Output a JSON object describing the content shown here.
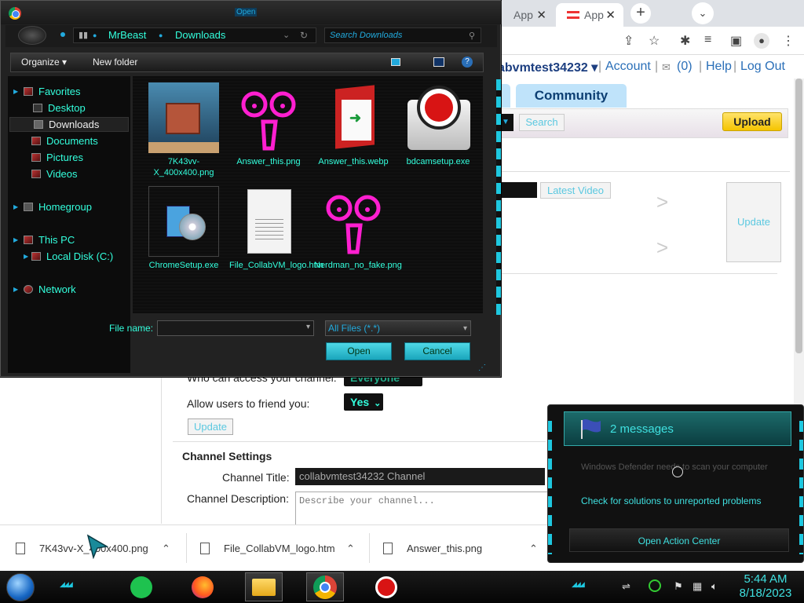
{
  "browser": {
    "tabs": [
      {
        "label": "App",
        "close": "✕"
      },
      {
        "label": "App",
        "close": "✕"
      }
    ],
    "new_tab": "+",
    "tab_menu": "⌄",
    "site": {
      "username": "abvmtest34232 ▾",
      "account": "Account",
      "messages": "(0)",
      "help": "Help",
      "logout": "Log Out",
      "sep": "|"
    },
    "nav_tab": "Community",
    "search_btn": "Search",
    "upload_btn": "Upload",
    "latest_video_btn": "Latest Video",
    "arrow": ">",
    "update_box": "Update",
    "settings": {
      "who_access_label": "Who can access your channel:",
      "who_access_value": "Everyone",
      "friend_label": "Allow users to friend you:",
      "friend_value": "Yes",
      "update_btn": "Update",
      "channel_settings_heading": "Channel Settings",
      "channel_title_label": "Channel Title:",
      "channel_title_value": "collabvmtest34232 Channel",
      "channel_desc_label": "Channel Description:",
      "channel_desc_placeholder": "Describe your channel..."
    },
    "downloads": [
      {
        "name": "7K43vv-X_400x400.png"
      },
      {
        "name": "File_CollabVM_logo.htm"
      },
      {
        "name": "Answer_this.png"
      }
    ],
    "chevron": "⌃"
  },
  "dialog": {
    "title": "Open",
    "breadcrumb": [
      "MrBeast",
      "Downloads"
    ],
    "search_placeholder": "Search Downloads",
    "organize": "Organize ▾",
    "new_folder": "New folder",
    "nav": {
      "favorites": "Favorites",
      "desktop": "Desktop",
      "downloads": "Downloads",
      "documents": "Documents",
      "pictures": "Pictures",
      "videos": "Videos",
      "homegroup": "Homegroup",
      "this_pc": "This PC",
      "local_disk": "Local Disk (C:)",
      "network": "Network"
    },
    "files": [
      {
        "name": "7K43vv-X_400x400.png"
      },
      {
        "name": "Answer_this.png"
      },
      {
        "name": "Answer_this.webp"
      },
      {
        "name": "bdcamsetup.exe"
      },
      {
        "name": "ChromeSetup.exe"
      },
      {
        "name": "File_CollabVM_logo.htm"
      },
      {
        "name": "Nerdman_no_fake.png"
      }
    ],
    "file_name_label": "File name:",
    "file_type": "All Files (*.*)",
    "open_btn": "Open",
    "cancel_btn": "Cancel"
  },
  "action_center": {
    "header": "2 messages",
    "message1": "Windows Defender needs to scan your computer",
    "message2": "Check for solutions to unreported problems",
    "footer": "Open Action Center"
  },
  "taskbar": {
    "time": "5:44 AM",
    "date": "8/18/2023"
  },
  "colors": {
    "accent": "#3fe0e0",
    "dialog_bg": "#222222",
    "button_cyan": "#1ec8e0",
    "upload_yellow": "#f5c400",
    "nav_blue": "#bfe3fa"
  }
}
